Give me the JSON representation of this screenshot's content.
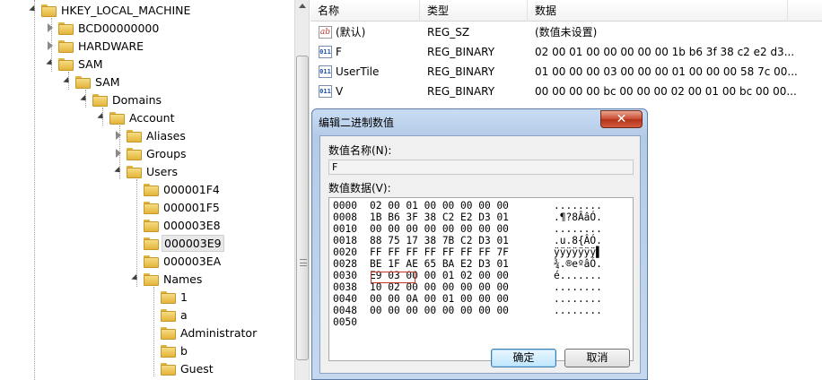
{
  "tree": {
    "nodes": [
      {
        "label": "HKEY_LOCAL_MACHINE",
        "state": "open"
      },
      {
        "label": "BCD00000000",
        "state": "closed"
      },
      {
        "label": "HARDWARE",
        "state": "closed"
      },
      {
        "label": "SAM",
        "state": "open"
      },
      {
        "label": "SAM",
        "state": "open"
      },
      {
        "label": "Domains",
        "state": "open"
      },
      {
        "label": "Account",
        "state": "open"
      },
      {
        "label": "Aliases",
        "state": "closed"
      },
      {
        "label": "Groups",
        "state": "closed"
      },
      {
        "label": "Users",
        "state": "open"
      },
      {
        "label": "000001F4",
        "state": "leaf"
      },
      {
        "label": "000001F5",
        "state": "leaf"
      },
      {
        "label": "000003E8",
        "state": "leaf"
      },
      {
        "label": "000003E9",
        "state": "leaf"
      },
      {
        "label": "000003EA",
        "state": "leaf"
      },
      {
        "label": "Names",
        "state": "open"
      },
      {
        "label": "1",
        "state": "leaf"
      },
      {
        "label": "a",
        "state": "leaf"
      },
      {
        "label": "Administrator",
        "state": "leaf"
      },
      {
        "label": "b",
        "state": "leaf"
      },
      {
        "label": "Guest",
        "state": "leaf"
      }
    ]
  },
  "list": {
    "headers": {
      "name": "名称",
      "type": "类型",
      "data": "数据"
    },
    "rows": [
      {
        "icon": "string-value-icon",
        "icon_text": "ab",
        "name": "(默认)",
        "type": "REG_SZ",
        "data": "(数值未设置)"
      },
      {
        "icon": "binary-value-icon",
        "icon_text": "011",
        "name": "F",
        "type": "REG_BINARY",
        "data": "02 00 01 00 00 00 00 00 1b b6 3f 38 c2 e2 d3..."
      },
      {
        "icon": "binary-value-icon",
        "icon_text": "011",
        "name": "UserTile",
        "type": "REG_BINARY",
        "data": "01 00 00 00 03 00 00 00 01 00 00 00 58 7c 00..."
      },
      {
        "icon": "binary-value-icon",
        "icon_text": "011",
        "name": "V",
        "type": "REG_BINARY",
        "data": "00 00 00 00 bc 00 00 00 02 00 01 00 bc 00 00..."
      }
    ]
  },
  "dialog": {
    "title": "编辑二进制数值",
    "close_label": "✕",
    "value_name_label": "数值名称(N):",
    "value_name": "F",
    "value_data_label": "数值数据(V):",
    "hex_lines": [
      {
        "offset": "0000",
        "bytes": "02 00 01 00 00 00 00 00",
        "ascii": "........"
      },
      {
        "offset": "0008",
        "bytes": "1B B6 3F 38 C2 E2 D3 01",
        "ascii": ".¶?8ÂâÓ."
      },
      {
        "offset": "0010",
        "bytes": "00 00 00 00 00 00 00 00",
        "ascii": "........"
      },
      {
        "offset": "0018",
        "bytes": "88 75 17 38 7B C2 D3 01",
        "ascii": ".u.8{ÂÓ."
      },
      {
        "offset": "0020",
        "bytes": "FF FF FF FF FF FF FF 7F",
        "ascii": "ÿÿÿÿÿÿÿ▌"
      },
      {
        "offset": "0028",
        "bytes": "BE 1F AE 65 BA E2 D3 01",
        "ascii": "¾.®eºâÓ."
      },
      {
        "offset": "0030",
        "bytes": "E9 03 00 00 01 02 00 00",
        "ascii": "é......."
      },
      {
        "offset": "0038",
        "bytes": "10 02 00 00 00 00 00 00",
        "ascii": "........"
      },
      {
        "offset": "0040",
        "bytes": "00 00 0A 00 01 00 00 00",
        "ascii": "........"
      },
      {
        "offset": "0048",
        "bytes": "00 00 00 00 00 00 00 00",
        "ascii": "........"
      },
      {
        "offset": "0050",
        "bytes": "",
        "ascii": ""
      }
    ],
    "ok_label": "确定",
    "cancel_label": "取消"
  }
}
